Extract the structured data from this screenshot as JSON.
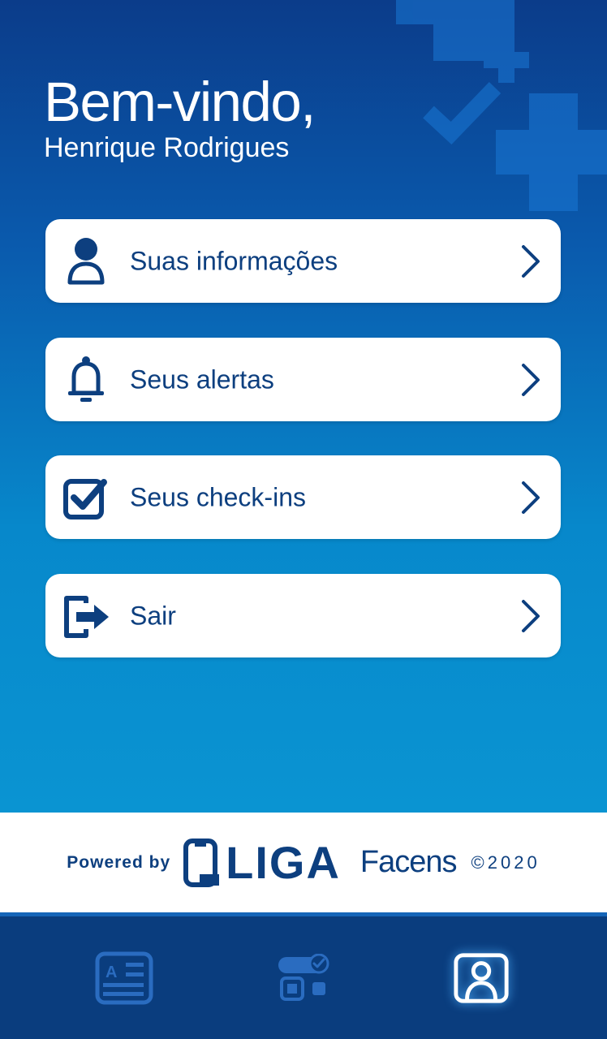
{
  "header": {
    "title": "Bem-vindo,",
    "username": "Henrique Rodrigues"
  },
  "menu": {
    "items": [
      {
        "label": "Suas informações",
        "icon": "user-icon"
      },
      {
        "label": "Seus alertas",
        "icon": "bell-icon"
      },
      {
        "label": "Seus check-ins",
        "icon": "checkbox-icon"
      },
      {
        "label": "Sair",
        "icon": "logout-icon"
      }
    ]
  },
  "footer": {
    "powered_by": "Powered by",
    "liga_logo_text": "LIGA",
    "facens_logo_text": "Facens",
    "copyright": "©2020"
  },
  "tabbar": {
    "tabs": [
      {
        "icon": "id-card-icon",
        "active": false
      },
      {
        "icon": "checkin-grid-icon",
        "active": false
      },
      {
        "icon": "profile-icon",
        "active": true
      }
    ]
  },
  "colors": {
    "primary_dark": "#0d3f7f",
    "gradient_top": "#0b3c8a",
    "gradient_bottom": "#0a94d2",
    "tabbar": "#0a3d7e",
    "tab_inactive": "#2a6cc0",
    "tab_active": "#ffffff"
  }
}
